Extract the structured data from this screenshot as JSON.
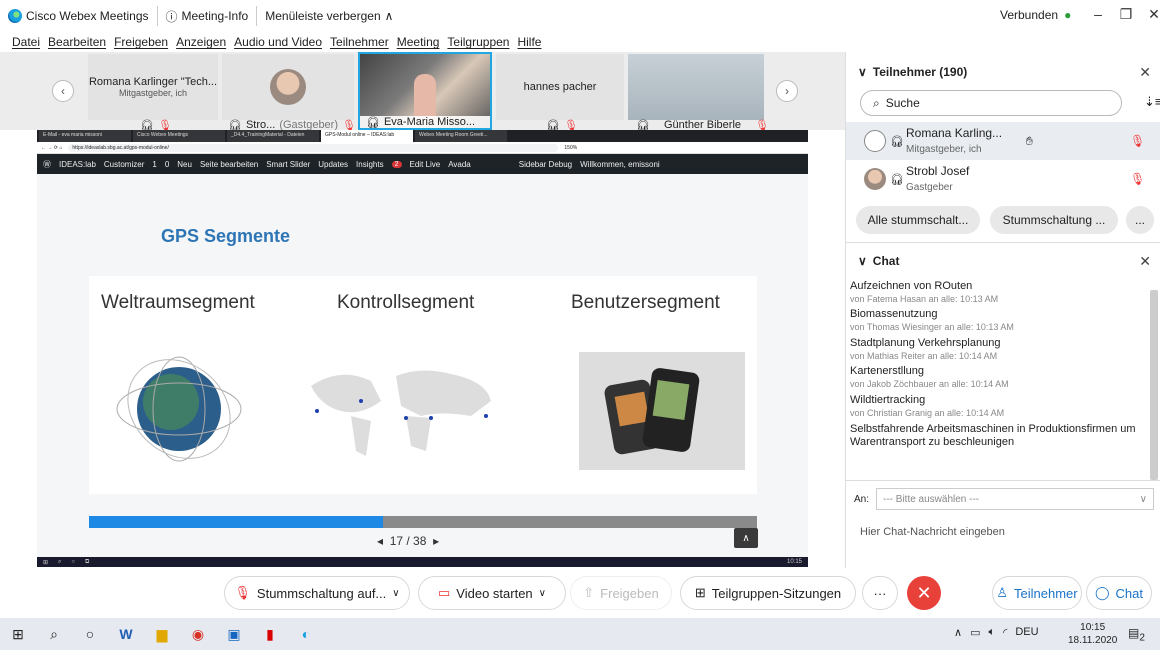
{
  "titlebar": {
    "app": "Cisco Webex Meetings",
    "info": "Meeting-Info",
    "menu_toggle": "Menüleiste verbergen",
    "status": "Verbunden"
  },
  "menu": [
    "Datei",
    "Bearbeiten",
    "Freigeben",
    "Anzeigen",
    "Audio und Video",
    "Teilnehmer",
    "Meeting",
    "Teilgruppen",
    "Hilfe"
  ],
  "filmstrip": [
    {
      "name": "Romana Karlinger \"Tech...",
      "sub": "Mitgastgeber, ich"
    },
    {
      "name": "Stro...",
      "role": "(Gastgeber)"
    },
    {
      "name": "Eva-Maria Misso..."
    },
    {
      "name": "hannes pacher"
    },
    {
      "name": "Günther Biberle"
    }
  ],
  "share": {
    "tabs": [
      "E-Mail - eva maria missoni",
      "Cisco Webex Meetings",
      "_D4.4_TrainingMaterial - Dateien",
      "GPS-Modul online – IDEAS:lab",
      "Webex Meeting Room Greeti..."
    ],
    "url": "https://ideaslab.sbg.ac.at/gps-modul-online/",
    "zoom": "150%",
    "wpbar": [
      "IDEAS:lab",
      "Customizer",
      "1",
      "0",
      "Neu",
      "Seite bearbeiten",
      "Smart Slider",
      "Updates",
      "Insights",
      "2",
      "Edit Live",
      "Avada",
      "Sidebar Debug",
      "Willkommen, emissoni"
    ],
    "slide_title": "GPS Segmente",
    "segments": [
      "Weltraumsegment",
      "Kontrollsegment",
      "Benutzersegment"
    ],
    "progress": 0.44,
    "page": "17 / 38",
    "clock": "10:15"
  },
  "toolbar": {
    "mute": "Stummschaltung auf...",
    "video": "Video starten",
    "share": "Freigeben",
    "breakout": "Teilgruppen-Sitzungen",
    "participants": "Teilnehmer",
    "chat": "Chat"
  },
  "panel": {
    "participants_title": "Teilnehmer (190)",
    "search": "Suche",
    "people": [
      {
        "name": "Romana Karling...",
        "role": "Mitgastgeber, ich"
      },
      {
        "name": "Strobl Josef",
        "role": "Gastgeber"
      }
    ],
    "mute_all": "Alle stummschalt...",
    "mute": "Stummschaltung ...",
    "more": "...",
    "chat_title": "Chat",
    "messages": [
      {
        "text": "Aufzeichnen von ROuten",
        "meta": "von Fatema Hasan an alle:  10:13 AM"
      },
      {
        "text": "Biomassenutzung",
        "meta": "von Thomas Wiesinger an alle:  10:13 AM"
      },
      {
        "text": "Stadtplanung Verkehrsplanung",
        "meta": "von Mathias Reiter an alle:  10:14 AM"
      },
      {
        "text": "Kartenerstllung",
        "meta": "von Jakob Zöchbauer an alle:  10:14 AM"
      },
      {
        "text": "Wildtiertracking",
        "meta": "von Christian Granig an alle:  10:14 AM"
      },
      {
        "text": "Selbstfahrende Arbeitsmaschinen in Produktionsfirmen um Warentransport zu beschleunigen"
      }
    ],
    "to_label": "An:",
    "recipient": "--- Bitte auswählen ---",
    "input_placeholder": "Hier Chat-Nachricht eingeben"
  },
  "taskbar": {
    "time": "10:15",
    "date": "18.11.2020",
    "lang": "DEU",
    "notif": "2"
  }
}
